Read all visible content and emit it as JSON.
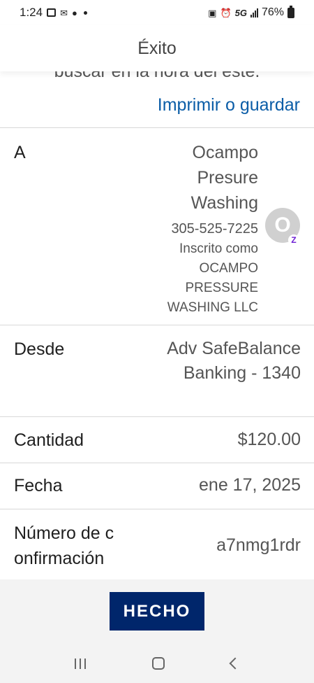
{
  "status_bar": {
    "time": "1:24",
    "network": "5G",
    "battery": "76%"
  },
  "header": {
    "title": "Éxito"
  },
  "content": {
    "cut_off_text": "buscar en la hora del este.",
    "print_link": "Imprimir o guardar",
    "to": {
      "label": "A",
      "name_lines": [
        "Ocampo",
        "Presure",
        "Washing"
      ],
      "phone": "305-525-7225",
      "registered_lines": [
        "Inscrito como",
        "OCAMPO",
        "PRESSURE",
        "WASHING LLC"
      ],
      "avatar_letter": "O",
      "badge_glyph": "Z"
    },
    "from": {
      "label": "Desde",
      "value_lines": [
        "Adv SafeBalance",
        "Banking - 1340"
      ]
    },
    "amount": {
      "label": "Cantidad",
      "value": "$120.00"
    },
    "date": {
      "label": "Fecha",
      "value": "ene 17, 2025"
    },
    "confirmation": {
      "label_lines": [
        "Número de c",
        "onfirmación"
      ],
      "value": "a7nmg1rdr"
    }
  },
  "footer": {
    "done_label": "HECHO"
  },
  "colors": {
    "link": "#0b5da7",
    "primary_button": "#00266b",
    "zelle": "#6d1ed4"
  }
}
